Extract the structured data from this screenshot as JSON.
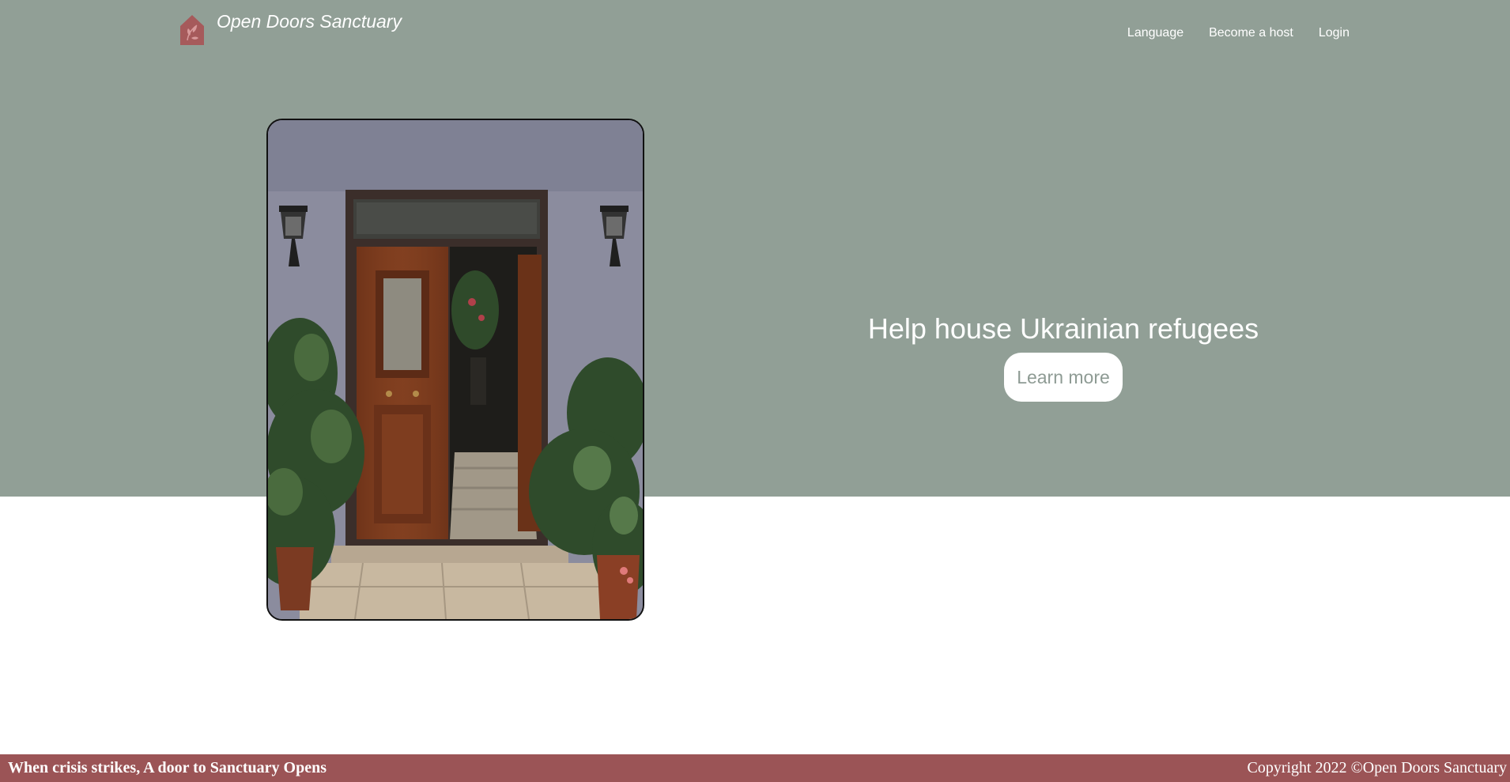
{
  "brand": {
    "name": "Open Doors Sanctuary",
    "logo_icon": "house-leaf-icon",
    "logo_color": "#a65a5b"
  },
  "nav": {
    "items": [
      {
        "label": "Language"
      },
      {
        "label": "Become a host"
      },
      {
        "label": "Login"
      }
    ]
  },
  "hero": {
    "background_color": "#919f96",
    "image_icon": "open-wooden-door-photo",
    "headline": "Help house Ukrainian refugees",
    "cta_label": "Learn more"
  },
  "footer": {
    "background_color": "#9b5456",
    "tagline": "When crisis strikes, A door to Sanctuary Opens",
    "copyright": "Copyright 2022 ©Open Doors Sanctuary"
  }
}
